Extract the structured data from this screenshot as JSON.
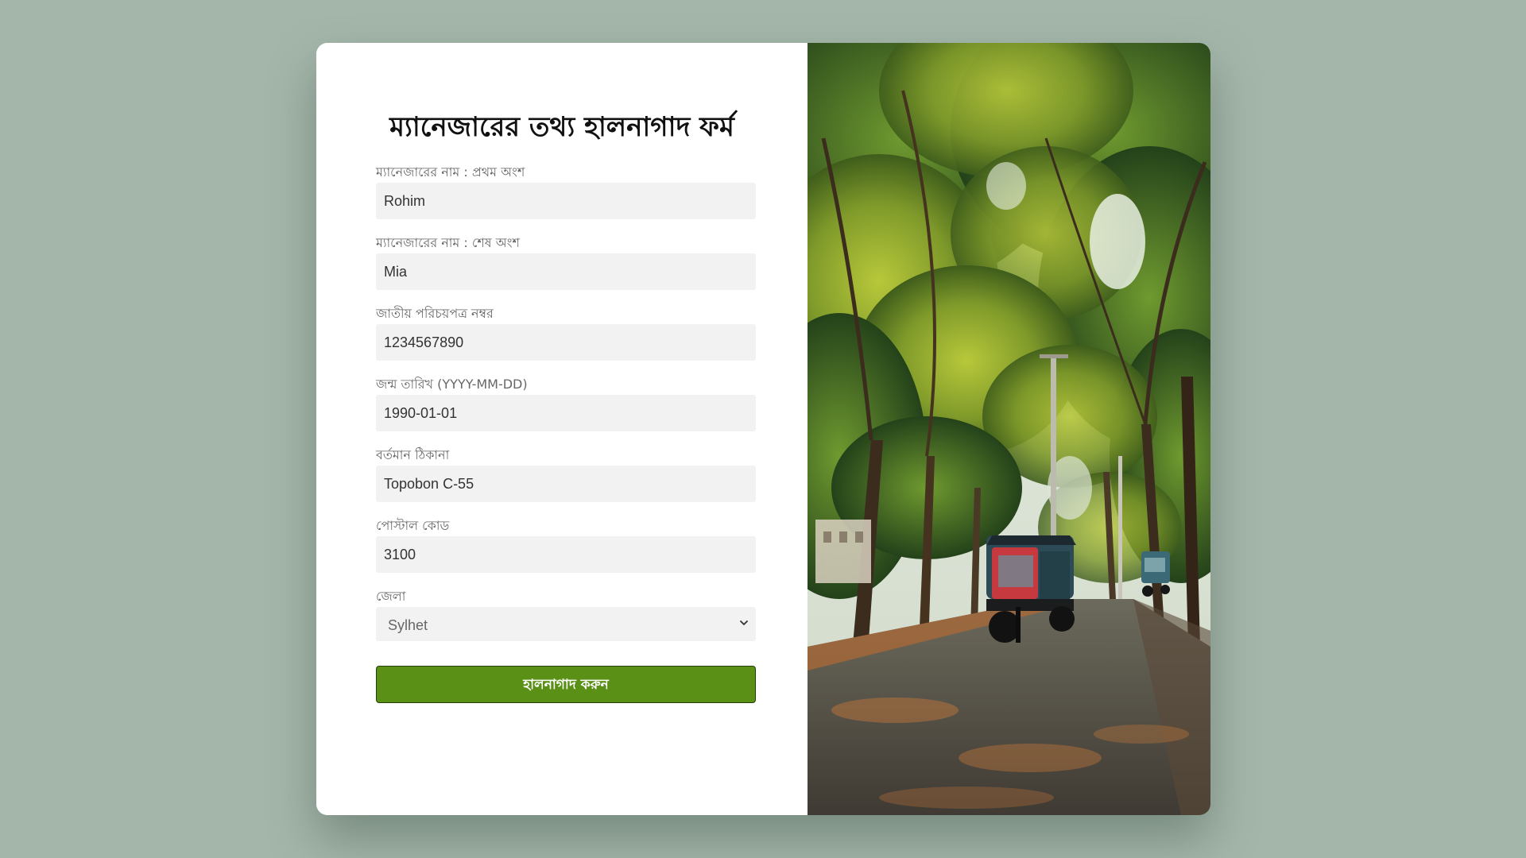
{
  "form": {
    "title": "ম্যানেজারের তথ্য হালনাগাদ ফর্ম",
    "fields": [
      {
        "label": "ম্যানেজারের নাম : প্রথম অংশ",
        "value": "Rohim"
      },
      {
        "label": "ম্যানেজারের নাম : শেষ অংশ",
        "value": "Mia"
      },
      {
        "label": "জাতীয় পরিচয়পত্র নম্বর",
        "value": "1234567890"
      },
      {
        "label": "জন্ম তারিখ (YYYY-MM-DD)",
        "value": "1990-01-01"
      },
      {
        "label": "বর্তমান ঠিকানা",
        "value": "Topobon C-55"
      },
      {
        "label": "পোস্টাল কোড",
        "value": "3100"
      }
    ],
    "district": {
      "label": "জেলা",
      "selected": "Sylhet"
    },
    "submit_label": "হালনাগাদ করুন"
  },
  "colors": {
    "page_background": "#a4b6aa",
    "button": "#5a9016",
    "input_background": "#f2f2f2"
  },
  "icons": {
    "select": "chevron-down-icon"
  }
}
